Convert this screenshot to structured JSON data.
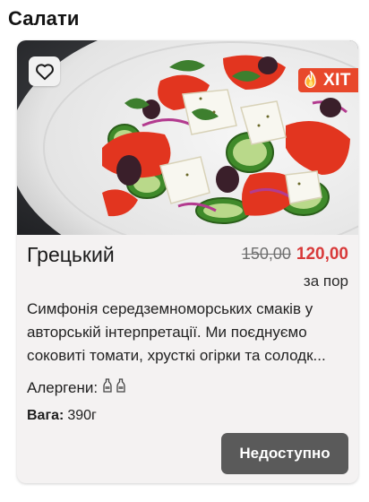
{
  "section": {
    "title": "Салати"
  },
  "product": {
    "name": "Грецький",
    "badge": "ХІТ",
    "old_price": "150,00",
    "new_price": "120,00",
    "unit": "за пор",
    "description_lines": [
      "Симфонія середземноморських смаків у",
      "авторській інтерпретації. Ми поєднуємо",
      "соковиті томати, хрусткі огірки та солодк..."
    ],
    "allergens_label": "Алергени:",
    "allergen_icons": [
      "bottle-icon",
      "bottle-icon"
    ],
    "weight_label": "Вага:",
    "weight_value": "390г",
    "action_label": "Недоступно"
  },
  "colors": {
    "badge": "#e8482b",
    "new_price": "#d83a3a",
    "button": "#5a5a5a",
    "card_bg": "#f4f2f2"
  }
}
